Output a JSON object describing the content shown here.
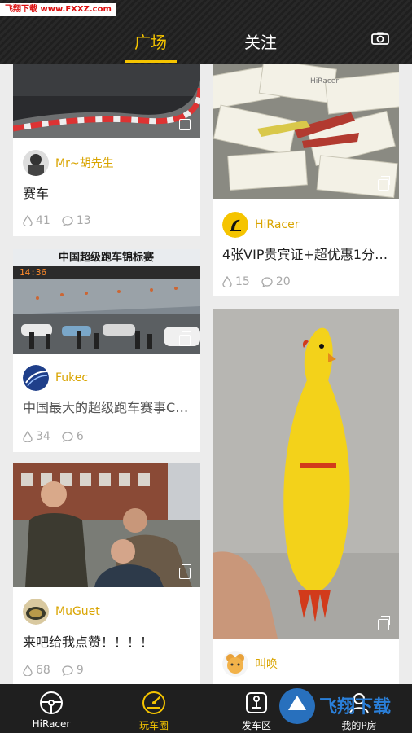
{
  "watermark": "飞翔下载 www.FXXZ.com",
  "header": {
    "tabs": [
      {
        "label": "广场",
        "active": true
      },
      {
        "label": "关注",
        "active": false
      }
    ],
    "camera_icon": "camera-icon"
  },
  "accent_color": "#f5c400",
  "posts": [
    {
      "user": "Mr~胡先生",
      "text": "赛车",
      "likes": "41",
      "comments": "13"
    },
    {
      "user": "HiRacer",
      "text": "4张VIP贵宾证+超优惠1分钱…",
      "likes": "15",
      "comments": "20"
    },
    {
      "user": "Fukec",
      "text": "中国最大的超级跑车赛事Chi…",
      "likes": "34",
      "comments": "6"
    },
    {
      "user": "MuGuet",
      "text": "来吧给我点赞！！！！",
      "likes": "68",
      "comments": "9"
    },
    {
      "user": "叫唤",
      "text": "",
      "likes": "",
      "comments": ""
    }
  ],
  "banner_text": "中国超级跑车锦标赛",
  "banner_time": "14:36",
  "tabbar": [
    {
      "label": "HiRacer",
      "icon": "steering-wheel-icon",
      "active": false
    },
    {
      "label": "玩车圈",
      "icon": "speedometer-icon",
      "active": true
    },
    {
      "label": "发车区",
      "icon": "gear-shift-icon",
      "active": false
    },
    {
      "label": "我的P房",
      "icon": "user-icon",
      "active": false
    }
  ],
  "logo_watermark": "飞翔下载"
}
